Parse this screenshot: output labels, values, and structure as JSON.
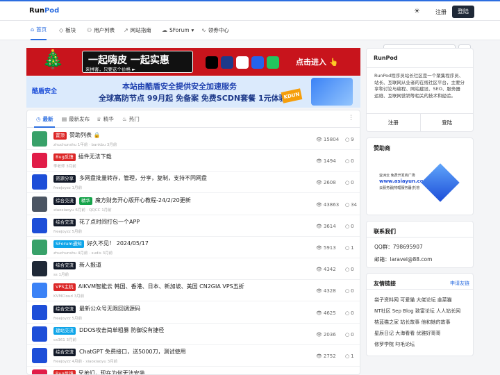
{
  "brand": {
    "part1": "Run",
    "part2": "Pod"
  },
  "header": {
    "register": "注册",
    "login": "登陆"
  },
  "nav": {
    "items": [
      {
        "label": "首页",
        "icon": "⌂",
        "active": true
      },
      {
        "label": "板块",
        "icon": "◇"
      },
      {
        "label": "用户列表",
        "icon": "⚇"
      },
      {
        "label": "网站指南",
        "icon": "↗"
      },
      {
        "label": "SForum",
        "icon": "☁",
        "dropdown": "▾"
      },
      {
        "label": "领券中心",
        "icon": "∿"
      }
    ],
    "search_placeholder": "Search..."
  },
  "banners": {
    "b1_title": "一起嗨皮 一起实惠",
    "b1_sub": "来拼客，只要这个价格 ►",
    "b1_cta": "点击进入 👆",
    "b2_logo": "酷盾安全",
    "b2_line1": "本站由酷盾安全提供安全加速服务",
    "b2_line2": "全球高防节点 99月起 免备案 免费SCDN套餐 1元体验",
    "b2_kdun": "KDUN"
  },
  "tabs": [
    {
      "label": "最新",
      "icon": "◷",
      "active": true
    },
    {
      "label": "最新发布",
      "icon": "▤"
    },
    {
      "label": "精华",
      "icon": "♕"
    },
    {
      "label": "热门",
      "icon": "♨"
    }
  ],
  "topics": [
    {
      "badge": "置顶",
      "badge_color": "#dc2626",
      "title": "赞助列表 🔒",
      "meta": "zhuchunshu 1年前 · bankbu 3月前",
      "views": "15804",
      "replies": "9",
      "avatar": "#38a169"
    },
    {
      "badge": "Bug反馈",
      "badge_color": "#dc2626",
      "title": "插件无法下载",
      "meta": "李老师 3月前",
      "views": "1494",
      "replies": "0",
      "avatar": "#e11d48"
    },
    {
      "badge": "资源分享",
      "badge_color": "#111827",
      "title": "多网盘批量转存，管理，分享，复制，支持不同网盘",
      "meta": "freejoyzz 1月前",
      "views": "2608",
      "replies": "0",
      "avatar": "#1d4ed8"
    },
    {
      "badge": "综合交流",
      "badge_color": "#111827",
      "badge2": "精华",
      "badge2_color": "#16a34a",
      "title": "魔方财务开心版开心教程-24/2/20更新",
      "meta": "xiaoxiaoyu 6月前 · QQCC 1月前",
      "views": "43863",
      "replies": "34",
      "avatar": "#4b5563"
    },
    {
      "badge": "综合交流",
      "badge_color": "#111827",
      "title": "花了点时间打包一个APP",
      "meta": "freejoyzz 5月前",
      "views": "3614",
      "replies": "0",
      "avatar": "#1d4ed8"
    },
    {
      "badge": "SForum通知",
      "badge_color": "#0ea5e9",
      "title": "好久不见！ 2024/05/17",
      "meta": "zhuchunshu 4月前 · sudis 3月前",
      "views": "5913",
      "replies": "1",
      "avatar": "#38a169"
    },
    {
      "badge": "综合交流",
      "badge_color": "#111827",
      "title": "新人报道",
      "meta": "ss 1月前",
      "views": "4342",
      "replies": "0",
      "avatar": "#1f2937"
    },
    {
      "badge": "VPS主机",
      "badge_color": "#dc2626",
      "title": "AIKVM智能云 韩国、香港、日本、新加坡、美国 CN2GIA VPS五折",
      "meta": "KVMCloud 3月前",
      "views": "4328",
      "replies": "0",
      "avatar": "#3b82f6"
    },
    {
      "badge": "综合交流",
      "badge_color": "#111827",
      "title": "最新公众号无限回调源码",
      "meta": "freejoyzz 5月前",
      "views": "4625",
      "replies": "0",
      "avatar": "#1d4ed8"
    },
    {
      "badge": "建站交流",
      "badge_color": "#0ea5e9",
      "title": "DDOS攻击简单粗暴 防御没有捷径",
      "meta": "cx361 3月前",
      "views": "2036",
      "replies": "0",
      "avatar": "#1d4ed8"
    },
    {
      "badge": "综合交流",
      "badge_color": "#111827",
      "title": "ChatGPT 免费接口，送5000刀，测试使用",
      "meta": "freejoyzz 4月前 · xiaoxiaoyu 3月前",
      "views": "2752",
      "replies": "1",
      "avatar": "#1d4ed8"
    },
    {
      "badge": "Bug反馈",
      "badge_color": "#dc2626",
      "title": "兄弟们，现在为何无法安装",
      "meta": "",
      "views": "",
      "replies": "",
      "avatar": "#e11d48"
    }
  ],
  "sidebar": {
    "about_title": "RunPod",
    "about_desc": "RunPod程序员站长社区是一个聚集程序员、站长、互联网从业者的在线社区平台，主要分享和讨论与编程、网站建设、SEO、服务器运维、互联网营销等相关的技术和经验。",
    "register": "注册",
    "login": "登陆",
    "sponsor_title": "赞助商",
    "ad_t1": "亚洲云 免费开发商广场",
    "ad_t2": "www.asiayun.com",
    "ad_t3": "云服务器|物理服务器|托管",
    "contact_title": "联系我们",
    "qq": "QQ群：798695907",
    "email": "邮箱：laravel@88.com",
    "links_title": "友情链接",
    "apply": "申请友链",
    "links": [
      "袋子资料网 可爱猫 大佬论坛 韭菜猫",
      "NT社区 Sep Blog 致富论坛 人人站长网",
      "桔蓝猫之家 站长故事 他和她的故事",
      "星辰日记 大海看看 优雅好哥哥",
      "修罗学院 叼毛论坛"
    ]
  }
}
